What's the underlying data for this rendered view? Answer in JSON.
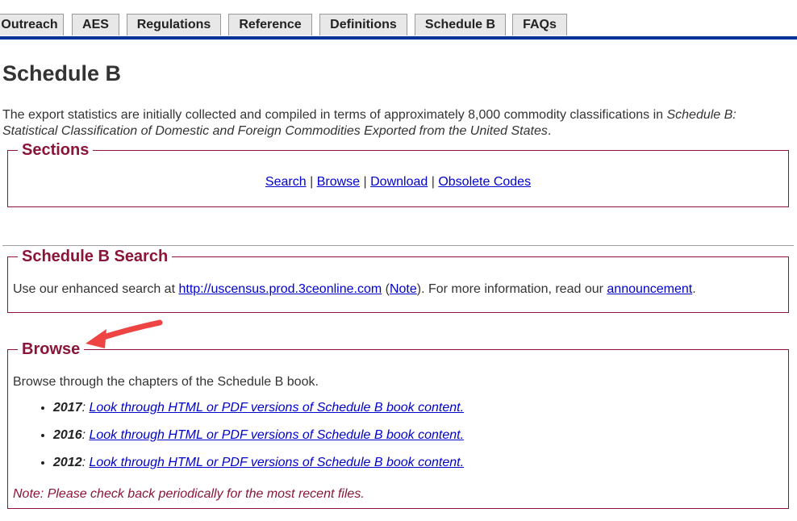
{
  "tabs": [
    "Outreach",
    "AES",
    "Regulations",
    "Reference",
    "Definitions",
    "Schedule B",
    "FAQs"
  ],
  "page_title": "Schedule B",
  "intro": {
    "text_before": "The export statistics are initially collected and compiled in terms of approximately 8,000 commodity classifications in ",
    "italic": "Schedule B: Statistical Classification of Domestic and Foreign Commodities Exported from the United States",
    "text_after": "."
  },
  "sections": {
    "legend": "Sections",
    "links": [
      "Search",
      "Browse",
      "Download",
      "Obsolete Codes"
    ],
    "separator": "|"
  },
  "search_box": {
    "legend": "Schedule B Search",
    "text1": "Use our enhanced search at ",
    "url_link": "http://uscensus.prod.3ceonline.com",
    "paren_open": " (",
    "note_link": "Note",
    "text2": "). For more information, read our ",
    "announcement_link": "announcement",
    "text3": "."
  },
  "browse": {
    "legend": "Browse",
    "description": "Browse through the chapters of the Schedule B book.",
    "items": [
      {
        "year": "2017",
        "sep": ": ",
        "link": "Look through HTML or PDF versions of Schedule B book content."
      },
      {
        "year": "2016",
        "sep": ": ",
        "link": "Look through HTML or PDF versions of Schedule B book content."
      },
      {
        "year": "2012",
        "sep": ": ",
        "link": "Look through HTML or PDF versions of Schedule B book content."
      }
    ],
    "note": "Note: Please check back periodically for the most recent files."
  },
  "colors": {
    "accent": "#8b1538",
    "tab_underline": "#003399",
    "link": "#0000cc",
    "annotation_arrow": "#ee4444"
  }
}
